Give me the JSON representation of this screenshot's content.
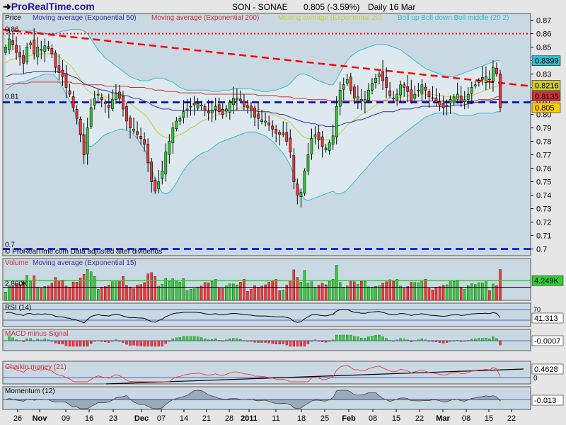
{
  "header": {
    "logo": "ProRealTime.com",
    "instrument": "SON - SONAE",
    "change": "0.805 (-3.59%)",
    "period": "Daily  16 Mar"
  },
  "colors": {
    "bg": "#e6e6e6",
    "panel_bg": "#c9d9e4",
    "band_fill": "#dde9ee",
    "bull": "#33cc33",
    "bear": "#ff3333",
    "ma50": "#333399",
    "ma200": "#cc3333",
    "ma20": "#cccc33",
    "boll": "#33bbcc",
    "trend": "#ff0000",
    "support": "#0000cc"
  },
  "chart_data": [
    {
      "type": "candlestick",
      "name": "price",
      "title": "Price",
      "legend": [
        "Moving average (Exponential 50)",
        "Moving average (Exponential 200)",
        "Moving average (Exponential 20)",
        "Boll up Boll down Boll middle (20 2)"
      ],
      "note": "© ProRealTime.com Data adjusted after dividends",
      "ylim": [
        0.695,
        0.875
      ],
      "y_ticks": [
        "0.87",
        "0.86",
        "0.85",
        "0.84",
        "0.83",
        "0.82",
        "0.81",
        "0.80",
        "0.79",
        "0.78",
        "0.77",
        "0.76",
        "0.75",
        "0.74",
        "0.73",
        "0.72",
        "0.71",
        "0.7"
      ],
      "left_labels": [
        "0.86",
        "0.81",
        "0.7"
      ],
      "price_tags": [
        {
          "label": "0.8399",
          "value": 0.8399,
          "color": "#33bbcc"
        },
        {
          "label": "0.8216",
          "value": 0.8216,
          "color": "#cccc33"
        },
        {
          "label": "0.8135",
          "value": 0.8135,
          "color": "#cc3333"
        },
        {
          "label": "0.805",
          "value": 0.805,
          "color": "#ffcc00"
        }
      ],
      "horizontal_lines": [
        {
          "value": 0.86,
          "style": "dotted",
          "color": "red"
        },
        {
          "value": 0.809,
          "style": "dashed",
          "color": "blue"
        },
        {
          "value": 0.7,
          "style": "dashed",
          "color": "blue"
        }
      ],
      "trendline": {
        "from": 0.863,
        "to": 0.821
      },
      "closes": [
        0.85,
        0.856,
        0.852,
        0.846,
        0.843,
        0.838,
        0.85,
        0.853,
        0.845,
        0.85,
        0.848,
        0.851,
        0.849,
        0.845,
        0.835,
        0.831,
        0.828,
        0.82,
        0.815,
        0.805,
        0.797,
        0.785,
        0.77,
        0.79,
        0.805,
        0.812,
        0.815,
        0.811,
        0.808,
        0.805,
        0.811,
        0.816,
        0.812,
        0.804,
        0.795,
        0.79,
        0.789,
        0.785,
        0.782,
        0.778,
        0.764,
        0.75,
        0.743,
        0.75,
        0.758,
        0.772,
        0.78,
        0.79,
        0.795,
        0.797,
        0.802,
        0.804,
        0.806,
        0.807,
        0.808,
        0.807,
        0.803,
        0.801,
        0.803,
        0.806,
        0.802,
        0.8,
        0.804,
        0.809,
        0.812,
        0.812,
        0.81,
        0.806,
        0.805,
        0.803,
        0.798,
        0.797,
        0.796,
        0.795,
        0.792,
        0.789,
        0.786,
        0.785,
        0.785,
        0.78,
        0.772,
        0.75,
        0.74,
        0.742,
        0.758,
        0.77,
        0.782,
        0.785,
        0.781,
        0.776,
        0.775,
        0.779,
        0.784,
        0.806,
        0.818,
        0.822,
        0.826,
        0.818,
        0.812,
        0.813,
        0.81,
        0.811,
        0.818,
        0.823,
        0.827,
        0.83,
        0.825,
        0.82,
        0.814,
        0.812,
        0.815,
        0.822,
        0.82,
        0.817,
        0.81,
        0.815,
        0.818,
        0.822,
        0.818,
        0.813,
        0.812,
        0.809,
        0.807,
        0.805,
        0.806,
        0.811,
        0.813,
        0.815,
        0.81,
        0.811,
        0.815,
        0.82,
        0.822,
        0.825,
        0.826,
        0.828,
        0.826,
        0.835,
        0.83,
        0.805
      ],
      "ma50": [
        0.828,
        0.829,
        0.83,
        0.83,
        0.83,
        0.83,
        0.831,
        0.831,
        0.832,
        0.832,
        0.832,
        0.832,
        0.832,
        0.832,
        0.832,
        0.832,
        0.831,
        0.83,
        0.829,
        0.828,
        0.827,
        0.825,
        0.823,
        0.822,
        0.821,
        0.82,
        0.819,
        0.818,
        0.818,
        0.817,
        0.816,
        0.816,
        0.815,
        0.814,
        0.814,
        0.813,
        0.812,
        0.812,
        0.811,
        0.81,
        0.809,
        0.807,
        0.806,
        0.805,
        0.804,
        0.804,
        0.804,
        0.803,
        0.803,
        0.803,
        0.803,
        0.803,
        0.803,
        0.803,
        0.803,
        0.803,
        0.803,
        0.803,
        0.803,
        0.803,
        0.803,
        0.803,
        0.803,
        0.803,
        0.803,
        0.803,
        0.803,
        0.803,
        0.803,
        0.803,
        0.803,
        0.802,
        0.802,
        0.802,
        0.802,
        0.801,
        0.801,
        0.8,
        0.8,
        0.799,
        0.798,
        0.797,
        0.796,
        0.795,
        0.794,
        0.794,
        0.793,
        0.793,
        0.792,
        0.792,
        0.791,
        0.791,
        0.791,
        0.791,
        0.792,
        0.793,
        0.794,
        0.794,
        0.795,
        0.796,
        0.796,
        0.797,
        0.798,
        0.799,
        0.8,
        0.801,
        0.802,
        0.802,
        0.802,
        0.802,
        0.803,
        0.804,
        0.804,
        0.804,
        0.804,
        0.805,
        0.805,
        0.806,
        0.806,
        0.806,
        0.806,
        0.806,
        0.806,
        0.806,
        0.806,
        0.806,
        0.807,
        0.807,
        0.807,
        0.807,
        0.808,
        0.808,
        0.809,
        0.809,
        0.81,
        0.81,
        0.81,
        0.811,
        0.811,
        0.811
      ],
      "ma200": [
        0.822,
        0.822,
        0.823,
        0.823,
        0.823,
        0.823,
        0.823,
        0.824,
        0.824,
        0.824,
        0.824,
        0.824,
        0.824,
        0.824,
        0.824,
        0.824,
        0.824,
        0.824,
        0.824,
        0.823,
        0.823,
        0.823,
        0.822,
        0.822,
        0.822,
        0.822,
        0.822,
        0.822,
        0.821,
        0.821,
        0.821,
        0.821,
        0.821,
        0.821,
        0.821,
        0.82,
        0.82,
        0.82,
        0.82,
        0.82,
        0.819,
        0.819,
        0.818,
        0.818,
        0.818,
        0.817,
        0.817,
        0.817,
        0.817,
        0.816,
        0.816,
        0.816,
        0.816,
        0.816,
        0.816,
        0.816,
        0.815,
        0.815,
        0.815,
        0.815,
        0.815,
        0.815,
        0.815,
        0.815,
        0.815,
        0.815,
        0.815,
        0.815,
        0.815,
        0.815,
        0.815,
        0.814,
        0.814,
        0.814,
        0.814,
        0.814,
        0.814,
        0.813,
        0.813,
        0.813,
        0.813,
        0.812,
        0.812,
        0.812,
        0.812,
        0.811,
        0.811,
        0.811,
        0.811,
        0.811,
        0.811,
        0.81,
        0.81,
        0.81,
        0.81,
        0.81,
        0.81,
        0.81,
        0.81,
        0.81,
        0.81,
        0.81,
        0.81,
        0.81,
        0.81,
        0.81,
        0.81,
        0.81,
        0.81,
        0.81,
        0.81,
        0.81,
        0.81,
        0.81,
        0.81,
        0.81,
        0.81,
        0.81,
        0.81,
        0.81,
        0.81,
        0.81,
        0.81,
        0.81,
        0.81,
        0.81,
        0.81,
        0.81,
        0.81,
        0.81,
        0.81,
        0.81,
        0.81,
        0.811,
        0.811,
        0.811,
        0.811,
        0.812,
        0.813,
        0.8135
      ],
      "ma20": [
        0.838,
        0.84,
        0.841,
        0.842,
        0.842,
        0.842,
        0.843,
        0.844,
        0.844,
        0.844,
        0.845,
        0.845,
        0.845,
        0.845,
        0.844,
        0.843,
        0.841,
        0.839,
        0.837,
        0.834,
        0.83,
        0.826,
        0.821,
        0.818,
        0.816,
        0.815,
        0.814,
        0.814,
        0.813,
        0.812,
        0.812,
        0.812,
        0.812,
        0.811,
        0.809,
        0.808,
        0.806,
        0.804,
        0.802,
        0.8,
        0.797,
        0.793,
        0.789,
        0.786,
        0.784,
        0.783,
        0.783,
        0.783,
        0.784,
        0.785,
        0.786,
        0.788,
        0.79,
        0.791,
        0.793,
        0.795,
        0.796,
        0.797,
        0.798,
        0.799,
        0.8,
        0.8,
        0.801,
        0.802,
        0.803,
        0.804,
        0.805,
        0.805,
        0.805,
        0.805,
        0.804,
        0.804,
        0.803,
        0.802,
        0.801,
        0.8,
        0.799,
        0.798,
        0.797,
        0.796,
        0.794,
        0.791,
        0.788,
        0.785,
        0.783,
        0.782,
        0.782,
        0.782,
        0.782,
        0.781,
        0.781,
        0.781,
        0.781,
        0.783,
        0.786,
        0.789,
        0.792,
        0.794,
        0.796,
        0.798,
        0.8,
        0.801,
        0.803,
        0.805,
        0.807,
        0.809,
        0.81,
        0.811,
        0.812,
        0.812,
        0.812,
        0.813,
        0.813,
        0.814,
        0.814,
        0.814,
        0.814,
        0.815,
        0.815,
        0.815,
        0.815,
        0.814,
        0.814,
        0.814,
        0.813,
        0.813,
        0.813,
        0.813,
        0.813,
        0.813,
        0.813,
        0.814,
        0.815,
        0.816,
        0.817,
        0.818,
        0.819,
        0.82,
        0.821,
        0.8216
      ],
      "boll_up": [
        0.86,
        0.861,
        0.862,
        0.862,
        0.862,
        0.862,
        0.862,
        0.862,
        0.862,
        0.861,
        0.861,
        0.86,
        0.86,
        0.86,
        0.86,
        0.861,
        0.862,
        0.862,
        0.863,
        0.863,
        0.863,
        0.863,
        0.862,
        0.86,
        0.856,
        0.852,
        0.848,
        0.845,
        0.842,
        0.84,
        0.838,
        0.836,
        0.834,
        0.832,
        0.83,
        0.828,
        0.827,
        0.826,
        0.825,
        0.825,
        0.825,
        0.826,
        0.827,
        0.827,
        0.827,
        0.826,
        0.825,
        0.824,
        0.822,
        0.82,
        0.819,
        0.818,
        0.818,
        0.818,
        0.818,
        0.818,
        0.818,
        0.818,
        0.817,
        0.817,
        0.817,
        0.818,
        0.818,
        0.818,
        0.819,
        0.819,
        0.819,
        0.819,
        0.819,
        0.819,
        0.818,
        0.818,
        0.817,
        0.817,
        0.817,
        0.818,
        0.818,
        0.819,
        0.82,
        0.821,
        0.823,
        0.826,
        0.829,
        0.83,
        0.83,
        0.829,
        0.828,
        0.826,
        0.825,
        0.824,
        0.823,
        0.822,
        0.822,
        0.826,
        0.831,
        0.836,
        0.84,
        0.843,
        0.845,
        0.847,
        0.848,
        0.849,
        0.85,
        0.851,
        0.852,
        0.852,
        0.852,
        0.852,
        0.851,
        0.85,
        0.849,
        0.848,
        0.846,
        0.844,
        0.842,
        0.84,
        0.838,
        0.836,
        0.834,
        0.833,
        0.832,
        0.831,
        0.83,
        0.829,
        0.828,
        0.828,
        0.828,
        0.829,
        0.83,
        0.831,
        0.832,
        0.833,
        0.834,
        0.835,
        0.836,
        0.837,
        0.838,
        0.839,
        0.84,
        0.8399
      ],
      "boll_dn": [
        0.818,
        0.82,
        0.822,
        0.823,
        0.824,
        0.824,
        0.825,
        0.826,
        0.827,
        0.828,
        0.829,
        0.83,
        0.83,
        0.83,
        0.828,
        0.825,
        0.82,
        0.815,
        0.81,
        0.805,
        0.797,
        0.789,
        0.781,
        0.777,
        0.776,
        0.778,
        0.78,
        0.783,
        0.785,
        0.786,
        0.787,
        0.788,
        0.789,
        0.789,
        0.788,
        0.787,
        0.785,
        0.782,
        0.778,
        0.774,
        0.768,
        0.76,
        0.752,
        0.746,
        0.742,
        0.741,
        0.742,
        0.745,
        0.749,
        0.754,
        0.758,
        0.762,
        0.765,
        0.767,
        0.769,
        0.771,
        0.772,
        0.773,
        0.775,
        0.777,
        0.779,
        0.78,
        0.781,
        0.782,
        0.783,
        0.784,
        0.785,
        0.786,
        0.787,
        0.787,
        0.787,
        0.786,
        0.785,
        0.784,
        0.782,
        0.78,
        0.777,
        0.774,
        0.771,
        0.767,
        0.762,
        0.755,
        0.747,
        0.741,
        0.737,
        0.736,
        0.737,
        0.738,
        0.739,
        0.74,
        0.741,
        0.742,
        0.743,
        0.741,
        0.741,
        0.742,
        0.744,
        0.747,
        0.75,
        0.753,
        0.756,
        0.759,
        0.762,
        0.765,
        0.768,
        0.771,
        0.773,
        0.776,
        0.778,
        0.78,
        0.782,
        0.784,
        0.786,
        0.788,
        0.79,
        0.792,
        0.794,
        0.796,
        0.798,
        0.799,
        0.8,
        0.801,
        0.801,
        0.801,
        0.801,
        0.801,
        0.801,
        0.8,
        0.799,
        0.799,
        0.799,
        0.799,
        0.8,
        0.801,
        0.801,
        0.801,
        0.801,
        0.801,
        0.802,
        0.802
      ]
    },
    {
      "type": "bar",
      "name": "volume",
      "title": "Volume",
      "legend": [
        "Moving average (Exponential 15)"
      ],
      "level_label": "2.800K",
      "level_value": 2800,
      "tag": "4.249K",
      "tag_value": 4249
    },
    {
      "type": "line",
      "name": "rsi",
      "title": "RSI (14)",
      "tag": "41.313",
      "ref_label": "70",
      "ref_levels": [
        30,
        70
      ]
    },
    {
      "type": "bar",
      "name": "macd",
      "title": "MACD minus Signal",
      "tag": "-0.0007"
    },
    {
      "type": "line",
      "name": "chaikin",
      "title": "Chaikin money (21)",
      "tag": "0.4628",
      "ref_label": "0"
    },
    {
      "type": "area",
      "name": "momentum",
      "title": "Momentum (12)",
      "tag": "-0.013"
    }
  ],
  "x_axis": {
    "labels": [
      "26",
      "Nov",
      "09",
      "16",
      "23",
      "Dec",
      "07",
      "14",
      "21",
      "28",
      "2011",
      "11",
      "18",
      "25",
      "Feb",
      "08",
      "15",
      "22",
      "Mar",
      "08",
      "15",
      "22"
    ],
    "bold": [
      "Nov",
      "Dec",
      "2011",
      "Feb",
      "Mar"
    ],
    "positions": [
      25,
      56,
      93,
      126,
      160,
      200,
      228,
      260,
      292,
      324,
      352,
      390,
      426,
      459,
      493,
      527,
      560,
      593,
      626,
      659,
      691,
      723
    ]
  }
}
